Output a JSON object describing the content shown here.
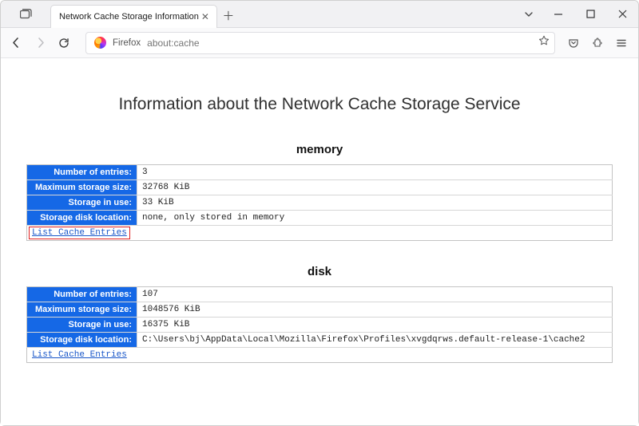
{
  "window": {
    "tab_title": "Network Cache Storage Information",
    "address_label": "Firefox",
    "address_url": "about:cache"
  },
  "page": {
    "title": "Information about the Network Cache Storage Service"
  },
  "sections": {
    "memory": {
      "heading": "memory",
      "rows": {
        "num_entries_label": "Number of entries:",
        "num_entries_value": "3",
        "max_size_label": "Maximum storage size:",
        "max_size_value": "32768 KiB",
        "in_use_label": "Storage in use:",
        "in_use_value": "33 KiB",
        "disk_loc_label": "Storage disk location:",
        "disk_loc_value": "none, only stored in memory"
      },
      "link_text": "List Cache Entries"
    },
    "disk": {
      "heading": "disk",
      "rows": {
        "num_entries_label": "Number of entries:",
        "num_entries_value": "107",
        "max_size_label": "Maximum storage size:",
        "max_size_value": "1048576 KiB",
        "in_use_label": "Storage in use:",
        "in_use_value": "16375 KiB",
        "disk_loc_label": "Storage disk location:",
        "disk_loc_value": "C:\\Users\\bj\\AppData\\Local\\Mozilla\\Firefox\\Profiles\\xvgdqrws.default-release-1\\cache2"
      },
      "link_text": "List Cache Entries"
    }
  }
}
